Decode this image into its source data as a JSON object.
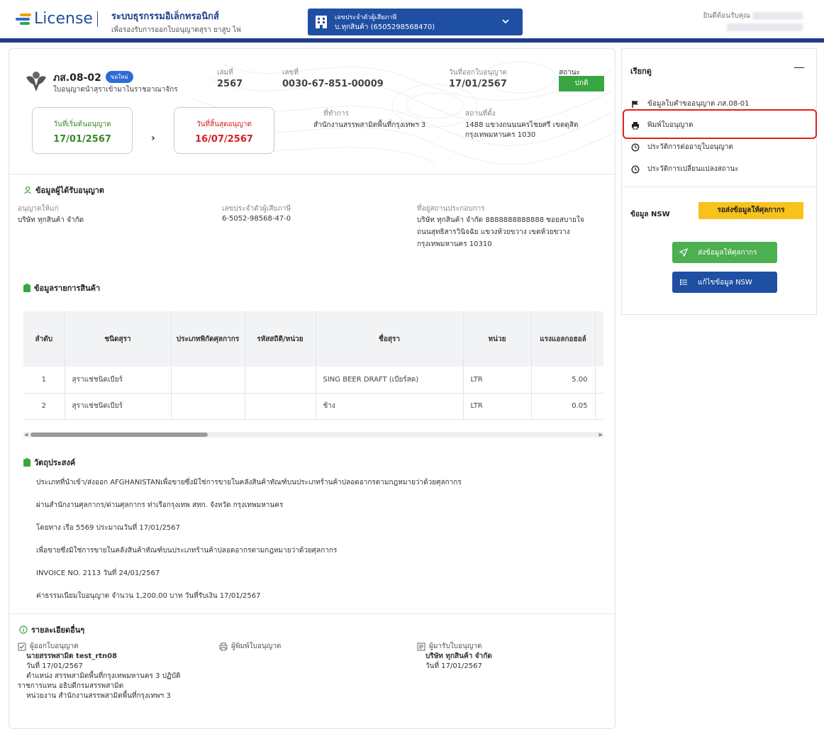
{
  "header": {
    "logo_text": "License",
    "system_title": "ระบบธุรกรรมอิเล็กทรอนิกส์",
    "system_subtitle": "เพื่อรองรับการออกใบอนุญาตสุรา ยาสูบ ไพ่",
    "taxpayer_label": "เลขประจำตัวผู้เสียภาษี",
    "taxpayer_value": "บ.ทุกสินค้า (6505298568470)",
    "welcome": "ยินดีต้อนรับคุณ",
    "welcome_name": "xxxxxxxxxxxx",
    "welcome_email": "xxxxxxxxxxxxxxxxxx"
  },
  "license": {
    "form_code": "ภส.08-02",
    "badge": "ขอใหม่",
    "form_desc": "ใบอนุญาตนำสุราเข้ามาในราชอาณาจักร",
    "book_label": "เล่มที่",
    "book_value": "2567",
    "no_label": "เลขที่",
    "no_value": "0030-67-851-00009",
    "issue_label": "วันที่ออกใบอนุญาต",
    "issue_value": "17/01/2567",
    "status_label": "สถานะ",
    "status_value": "ปกติ",
    "start_label": "วันที่เริ่มต้นอนุญาต",
    "start_value": "17/01/2567",
    "end_label": "วันที่สิ้นสุดอนุญาต",
    "end_value": "16/07/2567",
    "office_label": "ที่ทำการ",
    "office_value": "สำนักงานสรรพสามิตพื้นที่กรุงเทพฯ 3",
    "location_label": "สถานที่ตั้ง",
    "location_line1": "1488 แขวงถนนนครไชยศรี เขตดุสิต",
    "location_line2": "กรุงเทพมหานคร 1030"
  },
  "licensee": {
    "title": "ข้อมูลผู้ได้รับอนุญาต",
    "grantee_label": "อนุญาตให้แก่",
    "grantee_value": "บริษัท ทุกสินค้า จำกัด",
    "taxid_label": "เลขประจำตัวผู้เสียภาษี",
    "taxid_value": "6-5052-98568-47-0",
    "address_label": "ที่อยู่สถานประกอบการ",
    "address_line1": "บริษัท ทุกสินค้า จำกัด 8888888888888 ซอยสบายใจ",
    "address_line2": "ถนนสุทธิสารวินิจฉัย แขวงห้วยขวาง เขตห้วยขวาง",
    "address_line3": "กรุงเทพมหานคร 10310"
  },
  "products": {
    "title": "ข้อมูลรายการสินค้า",
    "columns": [
      "ลำดับ",
      "ชนิดสุรา",
      "ประเภทพิกัดศุลกากร",
      "รหัสสถิติ/หน่วย",
      "ชื่อสุรา",
      "หน่วย",
      "แรงแอลกอฮอล์"
    ],
    "rows": [
      [
        "1",
        "สุราแช่ชนิดเบียร์",
        "",
        "",
        "SING BEER DRAFT (เบียร์สด)",
        "LTR",
        "5.00"
      ],
      [
        "2",
        "สุราแช่ชนิดเบียร์",
        "",
        "",
        "ช้าง",
        "LTR",
        "0.05"
      ]
    ]
  },
  "purpose": {
    "title": "วัตถุประสงค์",
    "lines": [
      "ประเภทที่นำเข้า/ส่งออก AFGHANISTANเพื่อขายซึ่งมิใช่การขายในคลังสินค้าทัณฑ์บนประเภทร้านค้าปลอดอากรตามกฎหมายว่าด้วยศุลกากร",
      "ผ่านสำนักงานศุลกากร/ด่านศุลกากร  ท่าเรือกรุงเทพ สทก.   จังหวัด กรุงเทพมหานคร",
      "โดยทาง เรือ 5569   ประมาณวันที่ 17/01/2567",
      "เพื่อขายซึ่งมิใช่การขายในคลังสินค้าทัณฑ์บนประเภทร้านค้าปลอดอากรตามกฎหมายว่าด้วยศุลกากร",
      "INVOICE NO. 2113   วันที่ 24/01/2567",
      "ค่าธรรมเนียมใบอนุญาต จำนวน 1,200.00 บาท   วันที่รับเงิน 17/01/2567"
    ]
  },
  "other": {
    "title": "รายละเอียดอื่นๆ",
    "issuer_hdr": "ผู้ออกใบอนุญาต",
    "issuer_name": "นายสรรพสามิต test_rtn08",
    "issuer_date": "วันที่ 17/01/2567",
    "issuer_pos1": "ตำแหน่ง สรรพสามิตพื้นที่กรุงเทพมหานคร 3 ปฏิบัติ",
    "issuer_pos2": "ราชการแทน อธิบดีกรมสรรพสามิต",
    "issuer_unit": "หน่วยงาน สำนักงานสรรพสามิตพื้นที่กรุงเทพฯ 3",
    "printer_hdr": "ผู้พิมพ์ใบอนุญาต",
    "receiver_hdr": "ผู้มารับใบอนุญาต",
    "receiver_name": "บริษัท ทุกสินค้า จำกัด",
    "receiver_date": "วันที่ 17/01/2567"
  },
  "side": {
    "title": "เรียกดู",
    "items": [
      {
        "label": "ข้อมูลใบคำขออนุญาต ภส.08-01",
        "icon": "flag-icon"
      },
      {
        "label": "พิมพ์ใบอนุญาต",
        "icon": "print-icon"
      },
      {
        "label": "ประวัติการต่ออายุใบอนุญาต",
        "icon": "clock-icon"
      },
      {
        "label": "ประวัติการเปลี่ยนแปลงสถานะ",
        "icon": "clock-icon"
      }
    ],
    "nsw_label": "ข้อมูล NSW",
    "nsw_status": "รอส่งข้อมูลให้ศุลกากร",
    "send_btn": "ส่งข้อมูลให้ศุลกากร",
    "edit_btn": "แก้ไขข้อมูล NSW"
  },
  "colors": {
    "primary": "#1f4fa3",
    "status_green": "#3aa641",
    "date_green": "#3a8a2a",
    "date_red": "#d62020",
    "nsw_yellow": "#f7c21c",
    "send_green": "#4caf50",
    "highlight_red": "#e02020"
  }
}
